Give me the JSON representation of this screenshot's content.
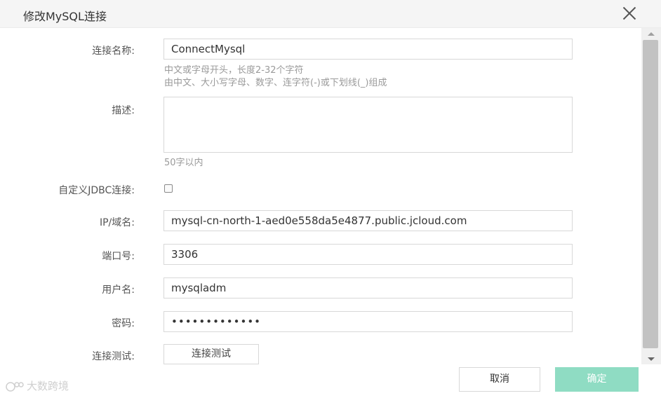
{
  "dialog": {
    "title": "修改MySQL连接",
    "close_icon": "close-icon"
  },
  "form": {
    "name_label": "连接名称:",
    "name_value": "ConnectMysql",
    "name_hint_1": "中文或字母开头，长度2-32个字符",
    "name_hint_2": "由中文、大小写字母、数字、连字符(-)或下划线(_)组成",
    "desc_label": "描述:",
    "desc_value": "",
    "desc_hint": "50字以内",
    "jdbc_label": "自定义JDBC连接:",
    "jdbc_checked": false,
    "host_label": "IP/域名:",
    "host_value": "mysql-cn-north-1-aed0e558da5e4877.public.jcloud.com",
    "port_label": "端口号:",
    "port_value": "3306",
    "user_label": "用户名:",
    "user_value": "mysqladm",
    "password_label": "密码:",
    "password_value": "•••••••••••••",
    "test_label": "连接测试:",
    "test_button": "连接测试"
  },
  "footer": {
    "cancel": "取消",
    "ok": "确定",
    "watermark": "大数跨境"
  },
  "colors": {
    "ok_button": "#8fdcc3",
    "header_bg": "#f5f5f5"
  }
}
